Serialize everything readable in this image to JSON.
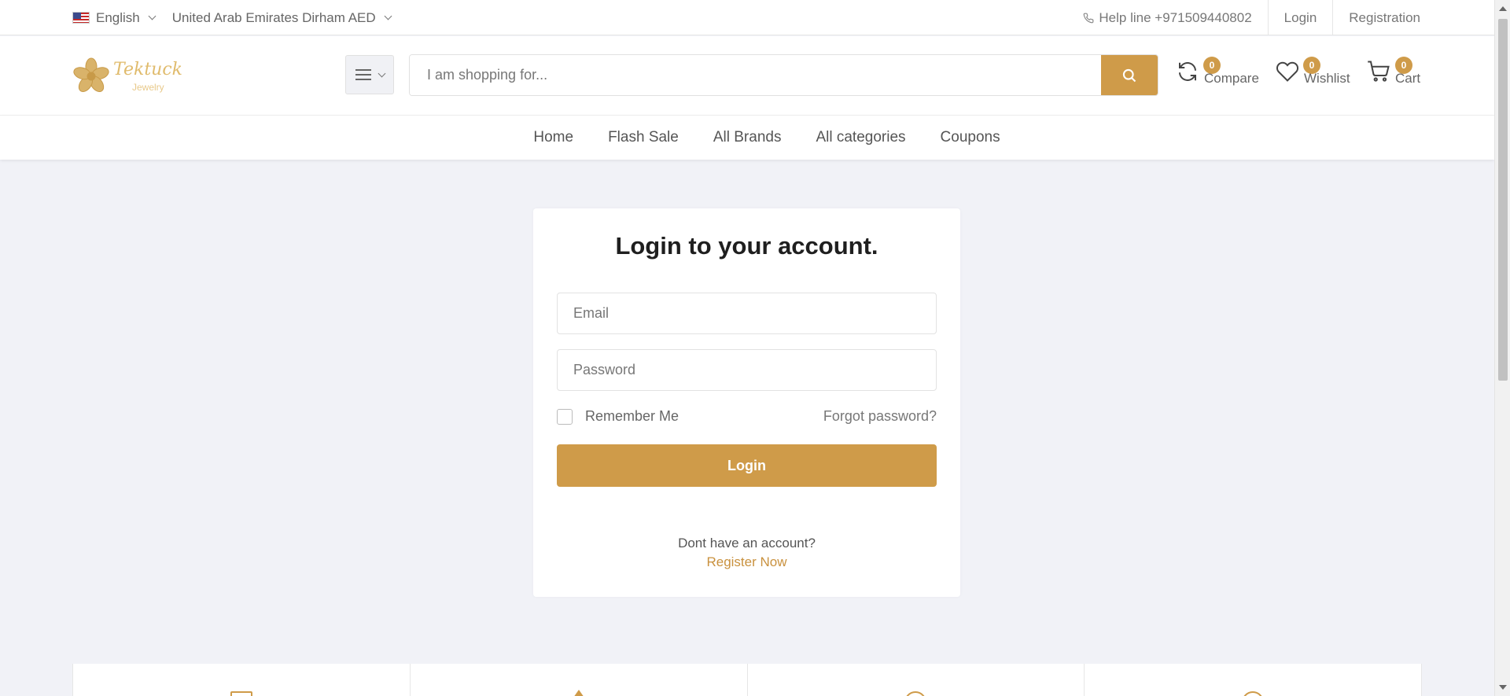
{
  "topbar": {
    "language": "English",
    "currency": "United Arab Emirates Dirham AED",
    "helpline": "Help line +971509440802",
    "login": "Login",
    "registration": "Registration"
  },
  "header": {
    "logo_text": "Tektuck",
    "logo_subtext": "Jewelry",
    "search_placeholder": "I am shopping for...",
    "compare": {
      "label": "Compare",
      "count": "0"
    },
    "wishlist": {
      "label": "Wishlist",
      "count": "0"
    },
    "cart": {
      "label": "Cart",
      "count": "0"
    }
  },
  "nav": {
    "items": [
      "Home",
      "Flash Sale",
      "All Brands",
      "All categories",
      "Coupons"
    ]
  },
  "login_form": {
    "title": "Login to your account.",
    "email_placeholder": "Email",
    "password_placeholder": "Password",
    "remember_me": "Remember Me",
    "forgot_password": "Forgot password?",
    "login_button": "Login",
    "no_account": "Dont have an account?",
    "register_now": "Register Now"
  },
  "colors": {
    "accent": "#cf9b49",
    "page_bg": "#f1f2f7"
  }
}
